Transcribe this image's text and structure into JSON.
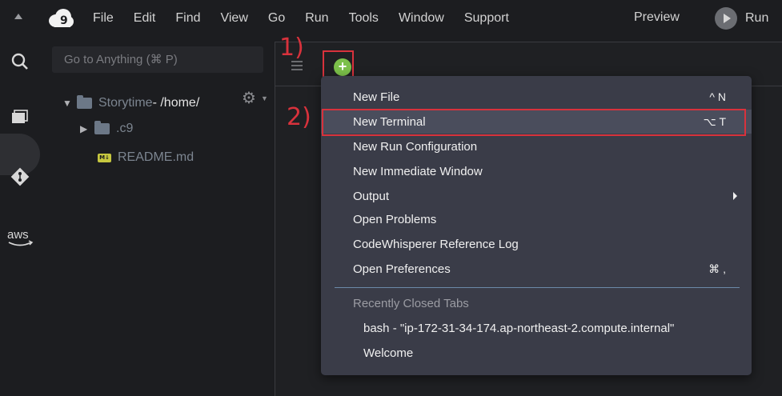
{
  "menubar": {
    "items": [
      "File",
      "Edit",
      "Find",
      "View",
      "Go",
      "Run",
      "Tools",
      "Window",
      "Support"
    ],
    "preview_label": "Preview",
    "run_label": "Run"
  },
  "activity_bar": {
    "icons": [
      "search-icon",
      "files-icon",
      "git-icon",
      "aws-icon"
    ],
    "aws_label": "aws"
  },
  "filetree": {
    "goto_placeholder": "Go to Anything (⌘ P)",
    "project_name": "Storytime",
    "project_path": " - /home/",
    "items": [
      {
        "name": ".c9",
        "type": "folder"
      },
      {
        "name": "README.md",
        "type": "markdown",
        "badge": "M↓"
      }
    ]
  },
  "annotations": {
    "step1": "1)",
    "step2": "2)",
    "color": "#d8323c"
  },
  "new_menu": {
    "plus_symbol": "+",
    "items": [
      {
        "label": "New File",
        "shortcut": "^ N"
      },
      {
        "label": "New Terminal",
        "shortcut": "⌥ T"
      },
      {
        "label": "New Run Configuration",
        "shortcut": ""
      },
      {
        "label": "New Immediate Window",
        "shortcut": ""
      },
      {
        "label": "Output",
        "shortcut": ""
      },
      {
        "label": "Open Problems",
        "shortcut": ""
      },
      {
        "label": "CodeWhisperer Reference Log",
        "shortcut": ""
      },
      {
        "label": "Open Preferences",
        "shortcut": "⌘ ,"
      }
    ],
    "recent_header": "Recently Closed Tabs",
    "recent_items": [
      "bash - \"ip-172-31-34-174.ap-northeast-2.compute.internal\"",
      "Welcome"
    ]
  },
  "colors": {
    "background": "#1c1d20",
    "menu_bg": "#3a3c48",
    "accent_green": "#7cc04a"
  }
}
